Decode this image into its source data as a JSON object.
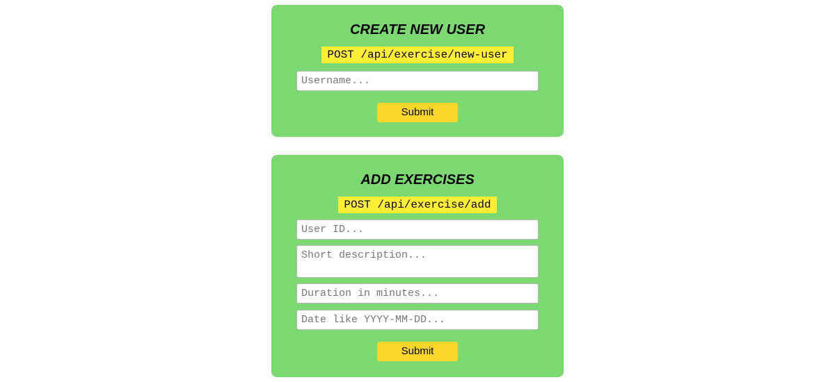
{
  "create_user": {
    "title": "CREATE NEW USER",
    "endpoint": "POST /api/exercise/new-user",
    "username_placeholder": "Username...",
    "submit_label": "Submit"
  },
  "add_exercises": {
    "title": "ADD EXERCISES",
    "endpoint": "POST /api/exercise/add",
    "userid_placeholder": "User ID...",
    "description_placeholder": "Short description...",
    "duration_placeholder": "Duration in minutes...",
    "date_placeholder": "Date like YYYY-MM-DD...",
    "submit_label": "Submit"
  },
  "colors": {
    "card_background": "#7cd972",
    "endpoint_highlight": "#ffee33",
    "button_background": "#f9d72a"
  }
}
